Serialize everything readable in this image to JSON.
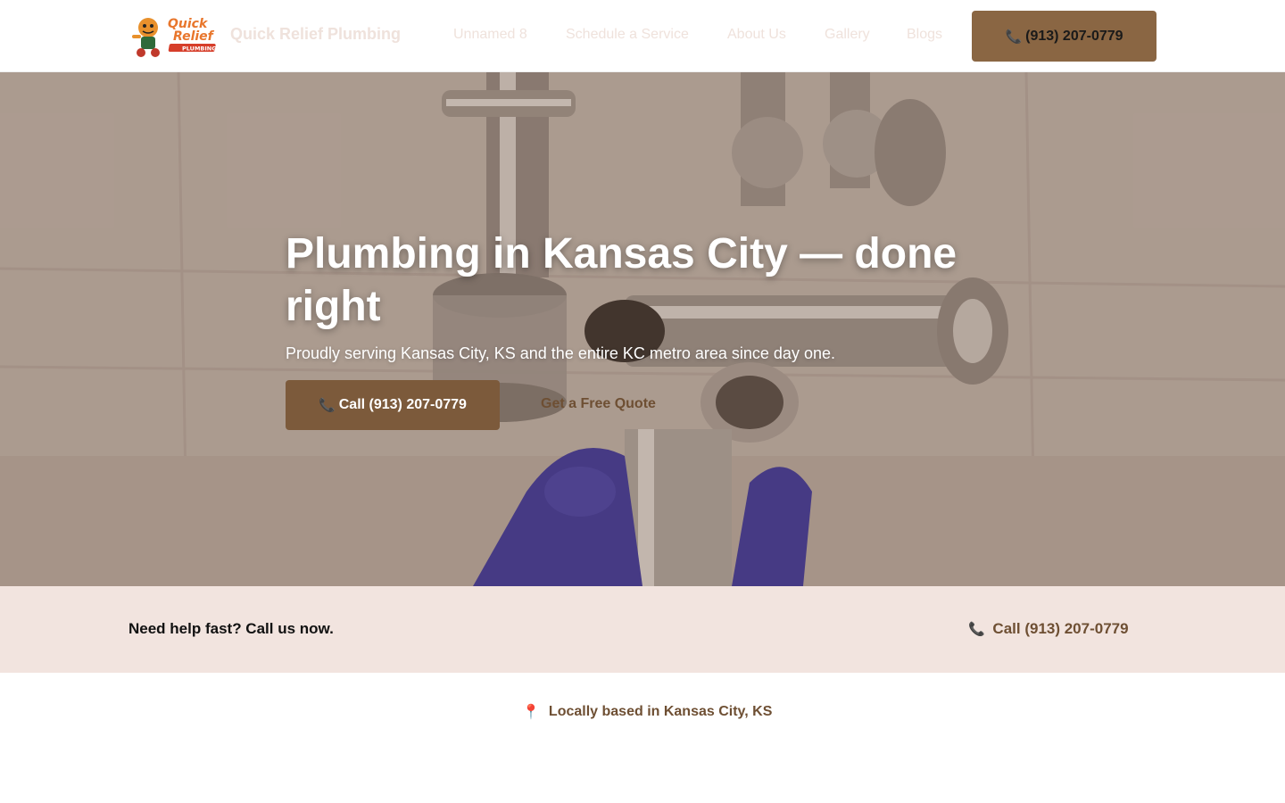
{
  "header": {
    "brand": "Quick Relief Plumbing",
    "logo_text_1": "Quick",
    "logo_text_2": "Relief",
    "logo_text_3": "PLUMBING",
    "nav": [
      "Unnamed 8",
      "Schedule a Service",
      "About Us",
      "Gallery",
      "Blogs"
    ],
    "phone_icon": "phone-icon",
    "phone_label": "(913) 207-0779"
  },
  "hero": {
    "title": "Plumbing in Kansas City — done right",
    "subtitle": "Proudly serving Kansas City, KS and the entire KC metro area since day one.",
    "call_button": "Call (913) 207-0779",
    "quote_link": "Get a Free Quote"
  },
  "help": {
    "text": "Need help fast? Call us now.",
    "call_label": "Call (913) 207-0779"
  },
  "local": {
    "icon": "map-pin-icon",
    "text": "Locally based in Kansas City, KS"
  },
  "colors": {
    "brand_brown": "#8a6643",
    "dark_brown": "#7c5a3b",
    "band_bg": "#f2e4df",
    "pin_red": "#d9362b"
  }
}
